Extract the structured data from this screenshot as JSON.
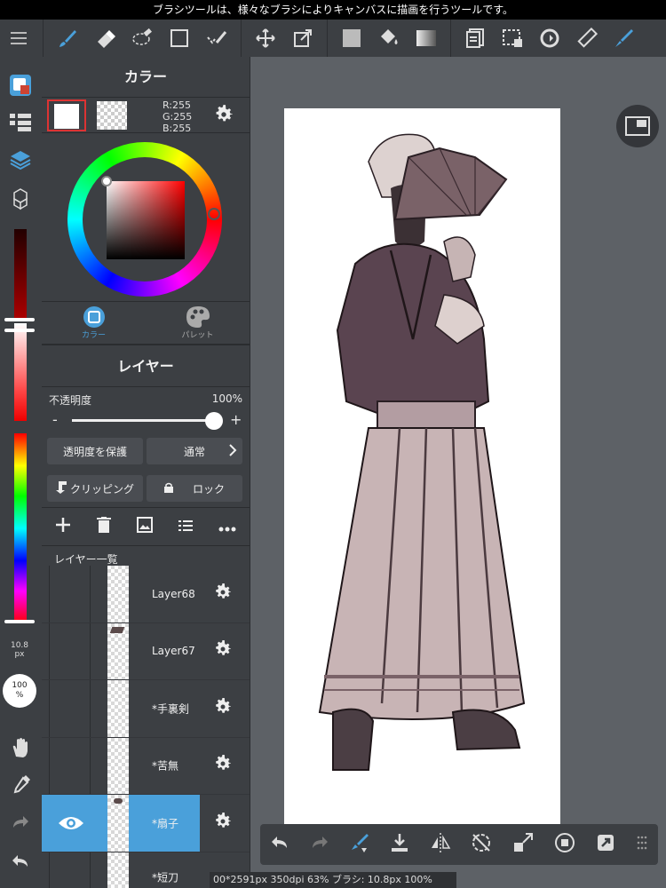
{
  "status_bar": {
    "text": "ブラシツールは、様々なブラシによりキャンバスに描画を行うツールです。"
  },
  "toolbar": {
    "items": [
      "menu-icon",
      "brush-icon",
      "eraser-icon",
      "lasso-eraser-icon",
      "rectangle-icon",
      "select-pen-icon",
      "move-icon",
      "transform-icon",
      "fill-color-icon",
      "bucket-icon",
      "gradient-icon",
      "layer-menu-icon",
      "selection-icon",
      "rotate-icon",
      "ruler-icon",
      "pen-active-icon"
    ]
  },
  "leftbar": {
    "brush_size": "10.8",
    "brush_unit": "px",
    "opacity": "100",
    "opacity_unit": "%"
  },
  "color_panel": {
    "title": "カラー",
    "r_label": "R:255",
    "g_label": "G:255",
    "b_label": "B:255",
    "tab_color": "カラー",
    "tab_palette": "パレット",
    "accent": "#4aa0da"
  },
  "layer_panel": {
    "title": "レイヤー",
    "opacity_label": "不透明度",
    "opacity_value": "100%",
    "minus": "-",
    "plus": "+",
    "protect_alpha": "透明度を保護",
    "blend_mode": "通常",
    "clipping": "クリッピング",
    "lock": "ロック",
    "list_title": "レイヤー一覧",
    "layers": [
      {
        "name": "Layer68"
      },
      {
        "name": "Layer67"
      },
      {
        "name": "*手裏剣"
      },
      {
        "name": "*苦無"
      },
      {
        "name": "*扇子"
      },
      {
        "name": "*短刀"
      }
    ]
  },
  "doc_info": "00*2591px 350dpi 63% ブラシ: 10.8px 100%"
}
